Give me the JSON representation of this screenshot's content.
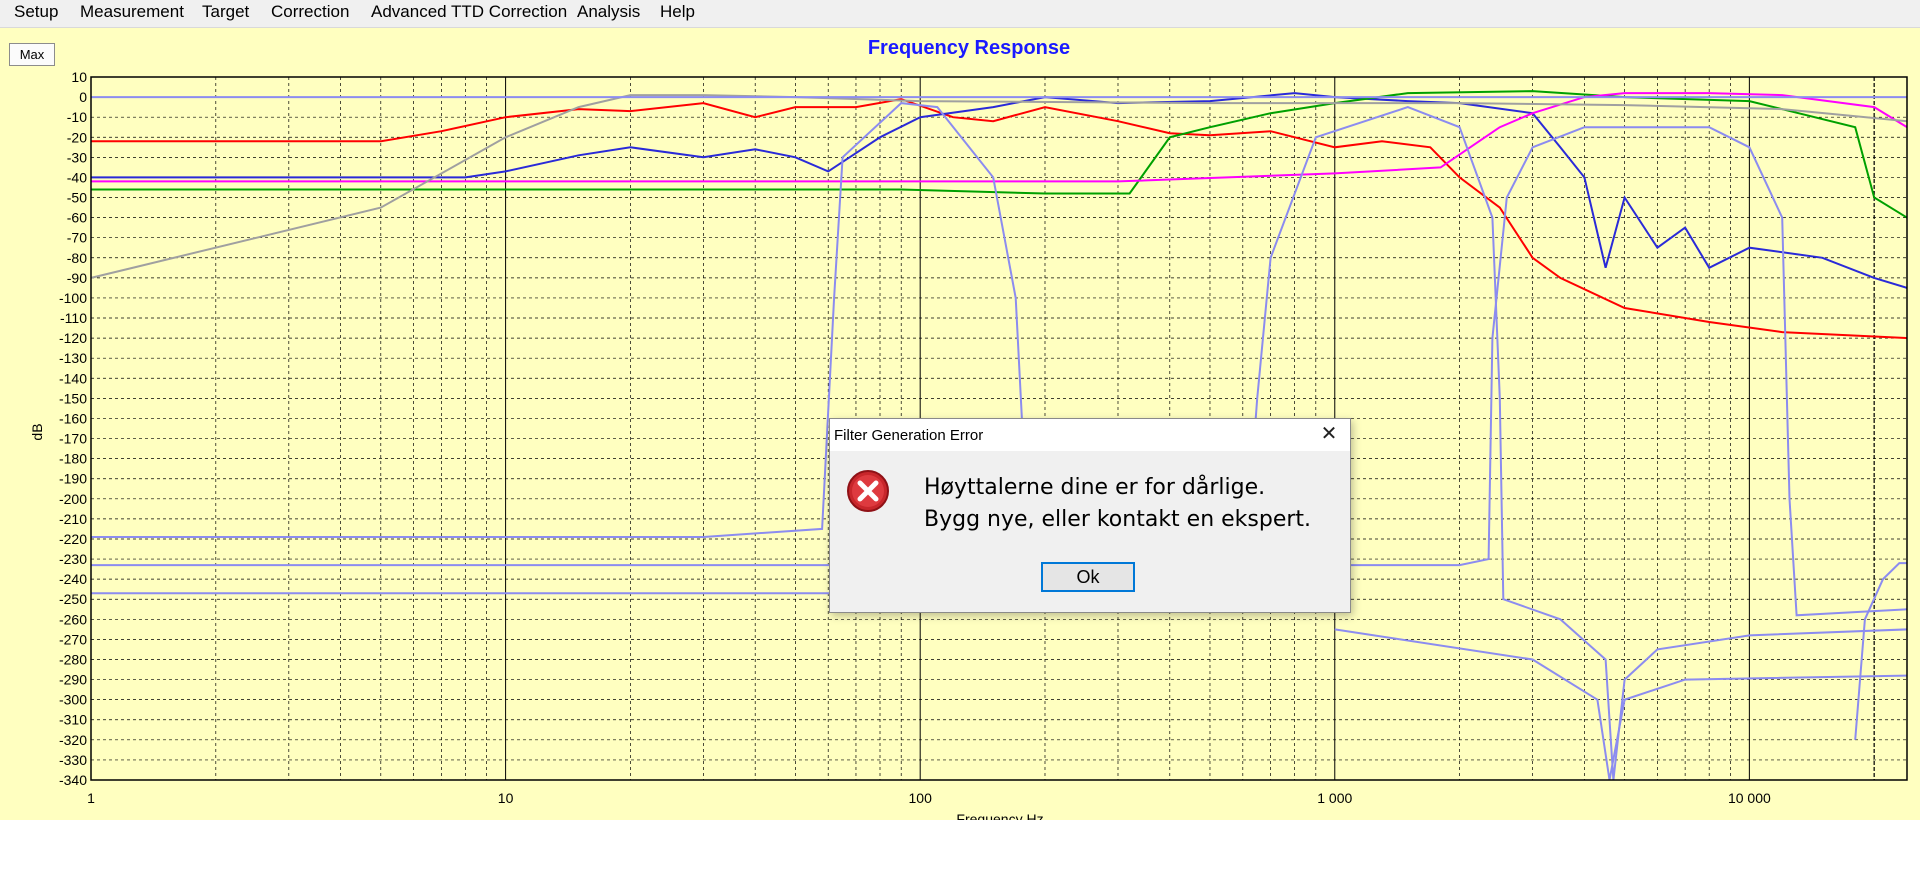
{
  "menu": {
    "items": [
      "Setup",
      "Measurement",
      "Target",
      "Correction",
      "Advanced TTD Correction",
      "Analysis",
      "Help"
    ]
  },
  "toolbar": {
    "max_label": "Max"
  },
  "chart_data": {
    "type": "line",
    "title": "Frequency Response",
    "xlabel": "Frequency Hz",
    "ylabel": "dB",
    "x_scale": "log",
    "xlim": [
      1,
      24000
    ],
    "ylim": [
      -340,
      10
    ],
    "x_ticks": [
      1,
      10,
      100,
      1000,
      10000
    ],
    "x_tick_labels": [
      "1",
      "10",
      "100",
      "1 000",
      "10 000"
    ],
    "y_ticks": [
      10,
      0,
      -10,
      -20,
      -30,
      -40,
      -50,
      -60,
      -70,
      -80,
      -90,
      -100,
      -110,
      -120,
      -130,
      -140,
      -150,
      -160,
      -170,
      -180,
      -190,
      -200,
      -210,
      -220,
      -230,
      -240,
      -250,
      -260,
      -270,
      -280,
      -290,
      -300,
      -310,
      -320,
      -330,
      -340
    ],
    "grid": true,
    "colors": {
      "background": "#ffffc0",
      "title": "#1a1aff"
    },
    "series": [
      {
        "color": "#ff0000",
        "points": [
          [
            1,
            -22
          ],
          [
            5,
            -22
          ],
          [
            7,
            -17
          ],
          [
            10,
            -10
          ],
          [
            15,
            -6
          ],
          [
            20,
            -7
          ],
          [
            30,
            -3
          ],
          [
            40,
            -10
          ],
          [
            50,
            -5
          ],
          [
            70,
            -5
          ],
          [
            90,
            -1
          ],
          [
            120,
            -10
          ],
          [
            150,
            -12
          ],
          [
            200,
            -5
          ],
          [
            300,
            -12
          ],
          [
            400,
            -18
          ],
          [
            500,
            -19
          ],
          [
            700,
            -17
          ],
          [
            1000,
            -25
          ],
          [
            1300,
            -22
          ],
          [
            1700,
            -25
          ],
          [
            2000,
            -40
          ],
          [
            2500,
            -55
          ],
          [
            3000,
            -80
          ],
          [
            3500,
            -90
          ],
          [
            5000,
            -105
          ],
          [
            8000,
            -112
          ],
          [
            12000,
            -117
          ],
          [
            24000,
            -120
          ]
        ]
      },
      {
        "color": "#2a2ad8",
        "points": [
          [
            1,
            -40
          ],
          [
            8,
            -40
          ],
          [
            10,
            -37
          ],
          [
            15,
            -29
          ],
          [
            20,
            -25
          ],
          [
            30,
            -30
          ],
          [
            40,
            -26
          ],
          [
            50,
            -30
          ],
          [
            60,
            -37
          ],
          [
            80,
            -20
          ],
          [
            100,
            -10
          ],
          [
            150,
            -5
          ],
          [
            200,
            0
          ],
          [
            300,
            -3
          ],
          [
            500,
            -2
          ],
          [
            800,
            2
          ],
          [
            1000,
            0
          ],
          [
            1500,
            -2
          ],
          [
            2000,
            -3
          ],
          [
            3000,
            -8
          ],
          [
            3500,
            -25
          ],
          [
            4000,
            -40
          ],
          [
            4500,
            -85
          ],
          [
            5000,
            -50
          ],
          [
            6000,
            -75
          ],
          [
            7000,
            -65
          ],
          [
            8000,
            -85
          ],
          [
            10000,
            -75
          ],
          [
            15000,
            -80
          ],
          [
            20000,
            -90
          ],
          [
            24000,
            -95
          ]
        ]
      },
      {
        "color": "#00a000",
        "points": [
          [
            1,
            -46
          ],
          [
            90,
            -46
          ],
          [
            200,
            -48
          ],
          [
            320,
            -48
          ],
          [
            400,
            -20
          ],
          [
            500,
            -15
          ],
          [
            700,
            -8
          ],
          [
            1000,
            -3
          ],
          [
            1500,
            2
          ],
          [
            3000,
            3
          ],
          [
            5000,
            0
          ],
          [
            10000,
            -2
          ],
          [
            18000,
            -15
          ],
          [
            20000,
            -50
          ],
          [
            24000,
            -60
          ]
        ]
      },
      {
        "color": "#ff00ff",
        "points": [
          [
            1,
            -42
          ],
          [
            300,
            -42
          ],
          [
            1000,
            -38
          ],
          [
            1800,
            -35
          ],
          [
            2500,
            -15
          ],
          [
            3000,
            -8
          ],
          [
            4000,
            0
          ],
          [
            5000,
            2
          ],
          [
            8000,
            2
          ],
          [
            12000,
            1
          ],
          [
            20000,
            -5
          ],
          [
            24000,
            -15
          ]
        ]
      },
      {
        "color": "#a0a0a0",
        "points": [
          [
            1,
            -90
          ],
          [
            5,
            -55
          ],
          [
            10,
            -20
          ],
          [
            15,
            -5
          ],
          [
            20,
            1
          ],
          [
            30,
            1
          ],
          [
            50,
            0
          ],
          [
            100,
            -2
          ],
          [
            500,
            -3
          ],
          [
            2000,
            -3
          ],
          [
            5000,
            -4
          ],
          [
            12000,
            -6
          ],
          [
            24000,
            -12
          ]
        ]
      },
      {
        "color": "#8c8cf0",
        "points": [
          [
            1,
            0
          ],
          [
            24000,
            0
          ]
        ]
      },
      {
        "color": "#8c8cf0",
        "points": [
          [
            1,
            -219
          ],
          [
            30,
            -219
          ],
          [
            58,
            -215
          ],
          [
            62,
            -100
          ],
          [
            65,
            -30
          ],
          [
            90,
            -3
          ],
          [
            110,
            -5
          ],
          [
            150,
            -40
          ],
          [
            170,
            -100
          ],
          [
            180,
            -200
          ]
        ]
      },
      {
        "color": "#8c8cf0",
        "points": [
          [
            1,
            -233
          ],
          [
            2000,
            -233
          ],
          [
            2350,
            -230
          ],
          [
            2400,
            -120
          ],
          [
            2600,
            -50
          ],
          [
            3000,
            -25
          ],
          [
            4000,
            -15
          ],
          [
            8000,
            -15
          ],
          [
            10000,
            -25
          ],
          [
            12000,
            -60
          ],
          [
            12500,
            -200
          ],
          [
            13000,
            -258
          ],
          [
            16000,
            -257
          ],
          [
            24000,
            -255
          ]
        ]
      },
      {
        "color": "#8c8cf0",
        "points": [
          [
            1,
            -247
          ],
          [
            600,
            -247
          ],
          [
            650,
            -150
          ],
          [
            700,
            -80
          ],
          [
            900,
            -20
          ],
          [
            1500,
            -5
          ],
          [
            2000,
            -15
          ],
          [
            2400,
            -60
          ],
          [
            2500,
            -150
          ],
          [
            2550,
            -250
          ],
          [
            3500,
            -260
          ],
          [
            4500,
            -280
          ],
          [
            4700,
            -340
          ],
          [
            5000,
            -290
          ],
          [
            6000,
            -275
          ],
          [
            10000,
            -268
          ],
          [
            24000,
            -265
          ]
        ]
      },
      {
        "color": "#8c8cf0",
        "points": [
          [
            1000,
            -265
          ],
          [
            3000,
            -280
          ],
          [
            4300,
            -300
          ],
          [
            4600,
            -340
          ],
          [
            5000,
            -300
          ],
          [
            7000,
            -290
          ],
          [
            24000,
            -288
          ]
        ]
      },
      {
        "color": "#8c8cf0",
        "points": [
          [
            18000,
            -320
          ],
          [
            19000,
            -260
          ],
          [
            21000,
            -240
          ],
          [
            23000,
            -232
          ],
          [
            24000,
            -232
          ]
        ]
      }
    ]
  },
  "dialog": {
    "title": "Filter Generation Error",
    "close_label": "✕",
    "message_line1": "Høyttalerne dine er for dårlige.",
    "message_line2": "Bygg nye, eller kontakt en ekspert.",
    "ok_label": "Ok",
    "icon": "error-icon"
  }
}
